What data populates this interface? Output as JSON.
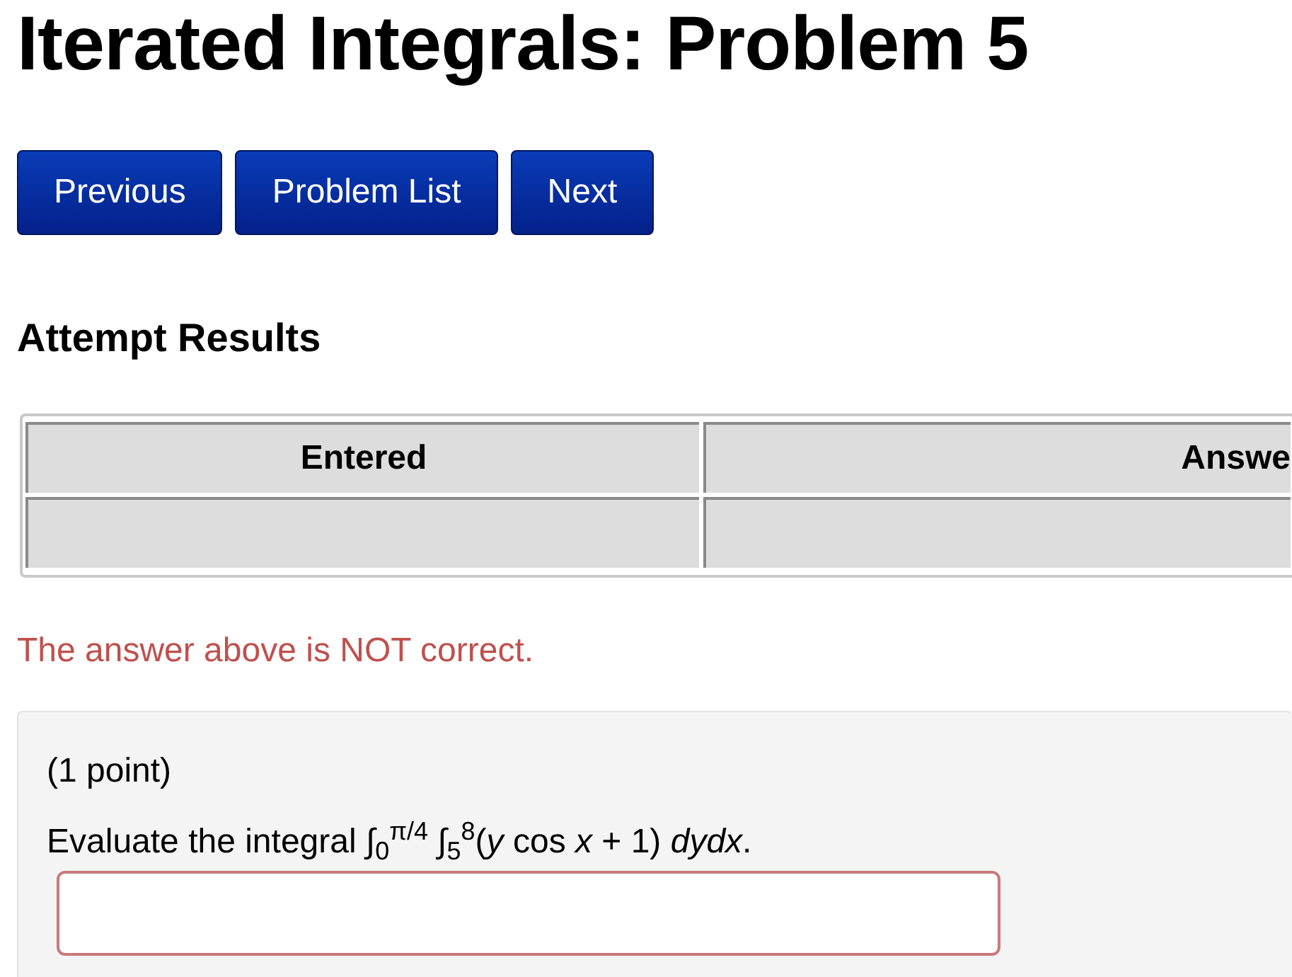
{
  "title": "Iterated Integrals: Problem 5",
  "nav_buttons": [
    "Previous",
    "Problem List",
    "Next"
  ],
  "results": {
    "heading": "Attempt Results",
    "columns": [
      "Entered",
      "Answe"
    ],
    "rows": [
      [
        "",
        ""
      ]
    ],
    "message": "The answer above is NOT correct."
  },
  "problem": {
    "points": "(1 point)",
    "statement": "Evaluate the integral ∫$_{0}$$^{π/4}$ ∫$_{5}$$^{8}$(*y* cos *x* + 1) *dydx*.",
    "answer": {
      "invalid": true
    }
  }
}
